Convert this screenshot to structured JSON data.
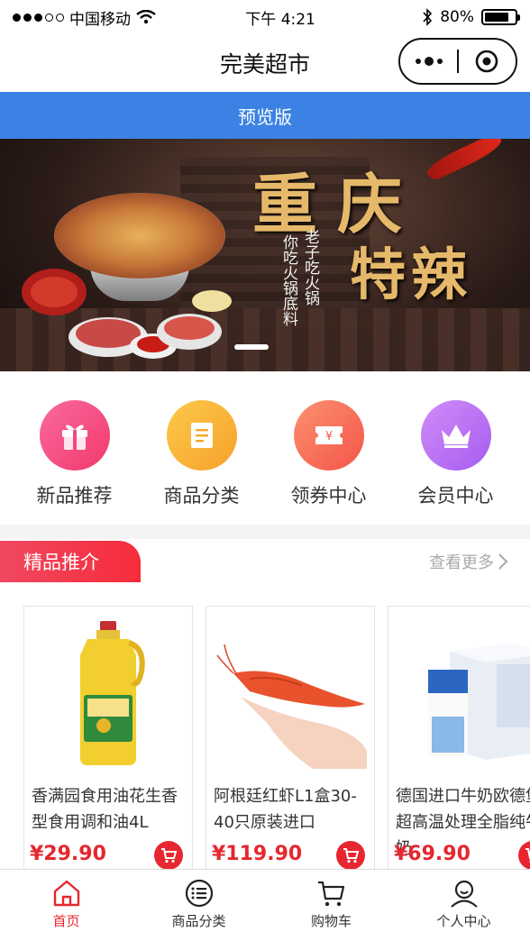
{
  "status_bar": {
    "carrier": "中国移动",
    "time": "下午 4:21",
    "battery": "80%",
    "battery_level": 0.8
  },
  "title_bar": {
    "title": "完美超市"
  },
  "preview_banner": {
    "label": "预览版"
  },
  "hero_banner": {
    "headline_1": "重庆",
    "headline_2": "特辣",
    "slogan_1": "老子吃火锅",
    "slogan_2": "你吃火锅底料"
  },
  "menu": {
    "items": [
      {
        "label": "新品推荐",
        "icon": "gift-icon",
        "color_from": "#f86aa0",
        "color_to": "#f2386a"
      },
      {
        "label": "商品分类",
        "icon": "document-icon",
        "color_from": "#fcc94a",
        "color_to": "#f6a12a"
      },
      {
        "label": "领券中心",
        "icon": "coupon-icon",
        "color_from": "#fb9270",
        "color_to": "#f45448"
      },
      {
        "label": "会员中心",
        "icon": "crown-icon",
        "color_from": "#d08cf7",
        "color_to": "#a65cf0"
      }
    ]
  },
  "featured": {
    "tag": "精品推介",
    "more": "查看更多"
  },
  "products": [
    {
      "name": "香满园食用油花生香型食用调和油4L",
      "price": "¥29.90"
    },
    {
      "name": "阿根廷红虾L1盒30-40只原装进口",
      "price": "¥119.90"
    },
    {
      "name": "德国进口牛奶欧德堡超高温处理全脂纯牛奶",
      "price": "¥69.90"
    }
  ],
  "tab_bar": {
    "tabs": [
      {
        "label": "首页",
        "icon": "home-icon",
        "active": true
      },
      {
        "label": "商品分类",
        "icon": "category-icon",
        "active": false
      },
      {
        "label": "购物车",
        "icon": "cart-icon",
        "active": false
      },
      {
        "label": "个人中心",
        "icon": "user-icon",
        "active": false
      }
    ]
  },
  "colors": {
    "accent": "#e5272e",
    "preview_blue": "#3b82e4"
  }
}
